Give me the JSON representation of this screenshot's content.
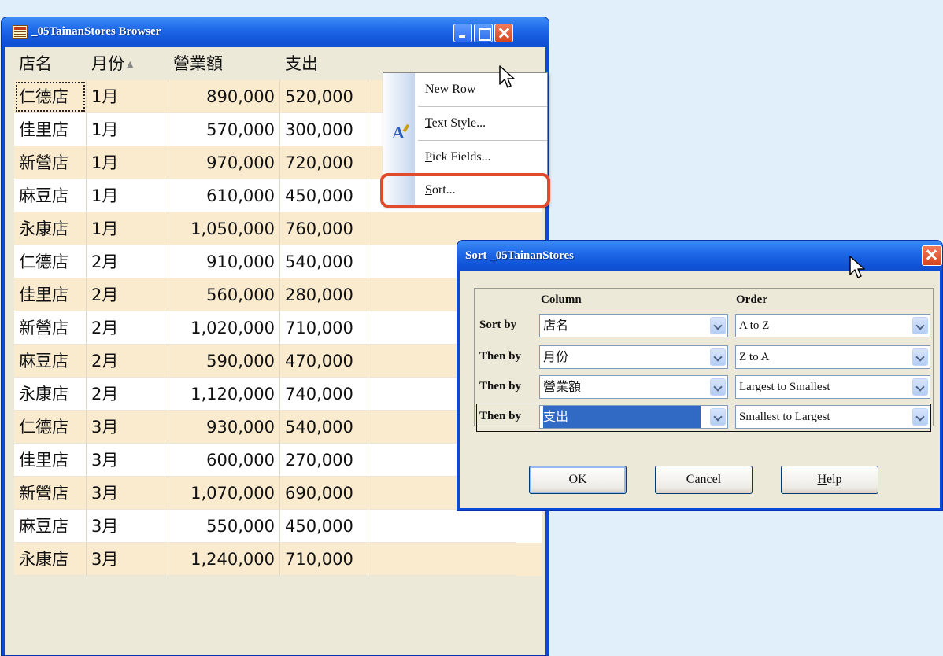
{
  "browser": {
    "title": "_05TainanStores Browser",
    "columns": [
      "店名",
      "月份",
      "營業額",
      "支出"
    ],
    "sort_indicator": "▲",
    "rows": [
      [
        "仁德店",
        "1月",
        "890,000",
        "520,000"
      ],
      [
        "佳里店",
        "1月",
        "570,000",
        "300,000"
      ],
      [
        "新營店",
        "1月",
        "970,000",
        "720,000"
      ],
      [
        "麻豆店",
        "1月",
        "610,000",
        "450,000"
      ],
      [
        "永康店",
        "1月",
        "1,050,000",
        "760,000"
      ],
      [
        "仁德店",
        "2月",
        "910,000",
        "540,000"
      ],
      [
        "佳里店",
        "2月",
        "560,000",
        "280,000"
      ],
      [
        "新營店",
        "2月",
        "1,020,000",
        "710,000"
      ],
      [
        "麻豆店",
        "2月",
        "590,000",
        "470,000"
      ],
      [
        "永康店",
        "2月",
        "1,120,000",
        "740,000"
      ],
      [
        "仁德店",
        "3月",
        "930,000",
        "540,000"
      ],
      [
        "佳里店",
        "3月",
        "600,000",
        "270,000"
      ],
      [
        "新營店",
        "3月",
        "1,070,000",
        "690,000"
      ],
      [
        "麻豆店",
        "3月",
        "550,000",
        "450,000"
      ],
      [
        "永康店",
        "3月",
        "1,240,000",
        "710,000"
      ]
    ]
  },
  "context_menu": {
    "items": [
      {
        "accel": "N",
        "rest": "ew Row"
      },
      {
        "accel": "T",
        "rest": "ext Style..."
      },
      {
        "accel": "P",
        "rest": "ick Fields..."
      },
      {
        "accel": "S",
        "rest": "ort..."
      }
    ],
    "highlight_color": "#e14a2a"
  },
  "sort_dialog": {
    "title": "Sort _05TainanStores",
    "column_header": "Column",
    "order_header": "Order",
    "rows": [
      {
        "label": "Sort by",
        "column": "店名",
        "order": "A to Z"
      },
      {
        "label": "Then by",
        "column": "月份",
        "order": "Z to A"
      },
      {
        "label": "Then by",
        "column": "營業額",
        "order": "Largest to Smallest"
      },
      {
        "label": "Then by",
        "column": "支出",
        "order": "Smallest to Largest"
      }
    ],
    "ok_label": "OK",
    "cancel_label": "Cancel",
    "help_accel": "H",
    "help_rest": "elp"
  },
  "colors": {
    "titlebar_blue": "#0a4ad8",
    "row_alt": "#faebcf",
    "selection": "#316ac5",
    "background": "#e1effb"
  }
}
